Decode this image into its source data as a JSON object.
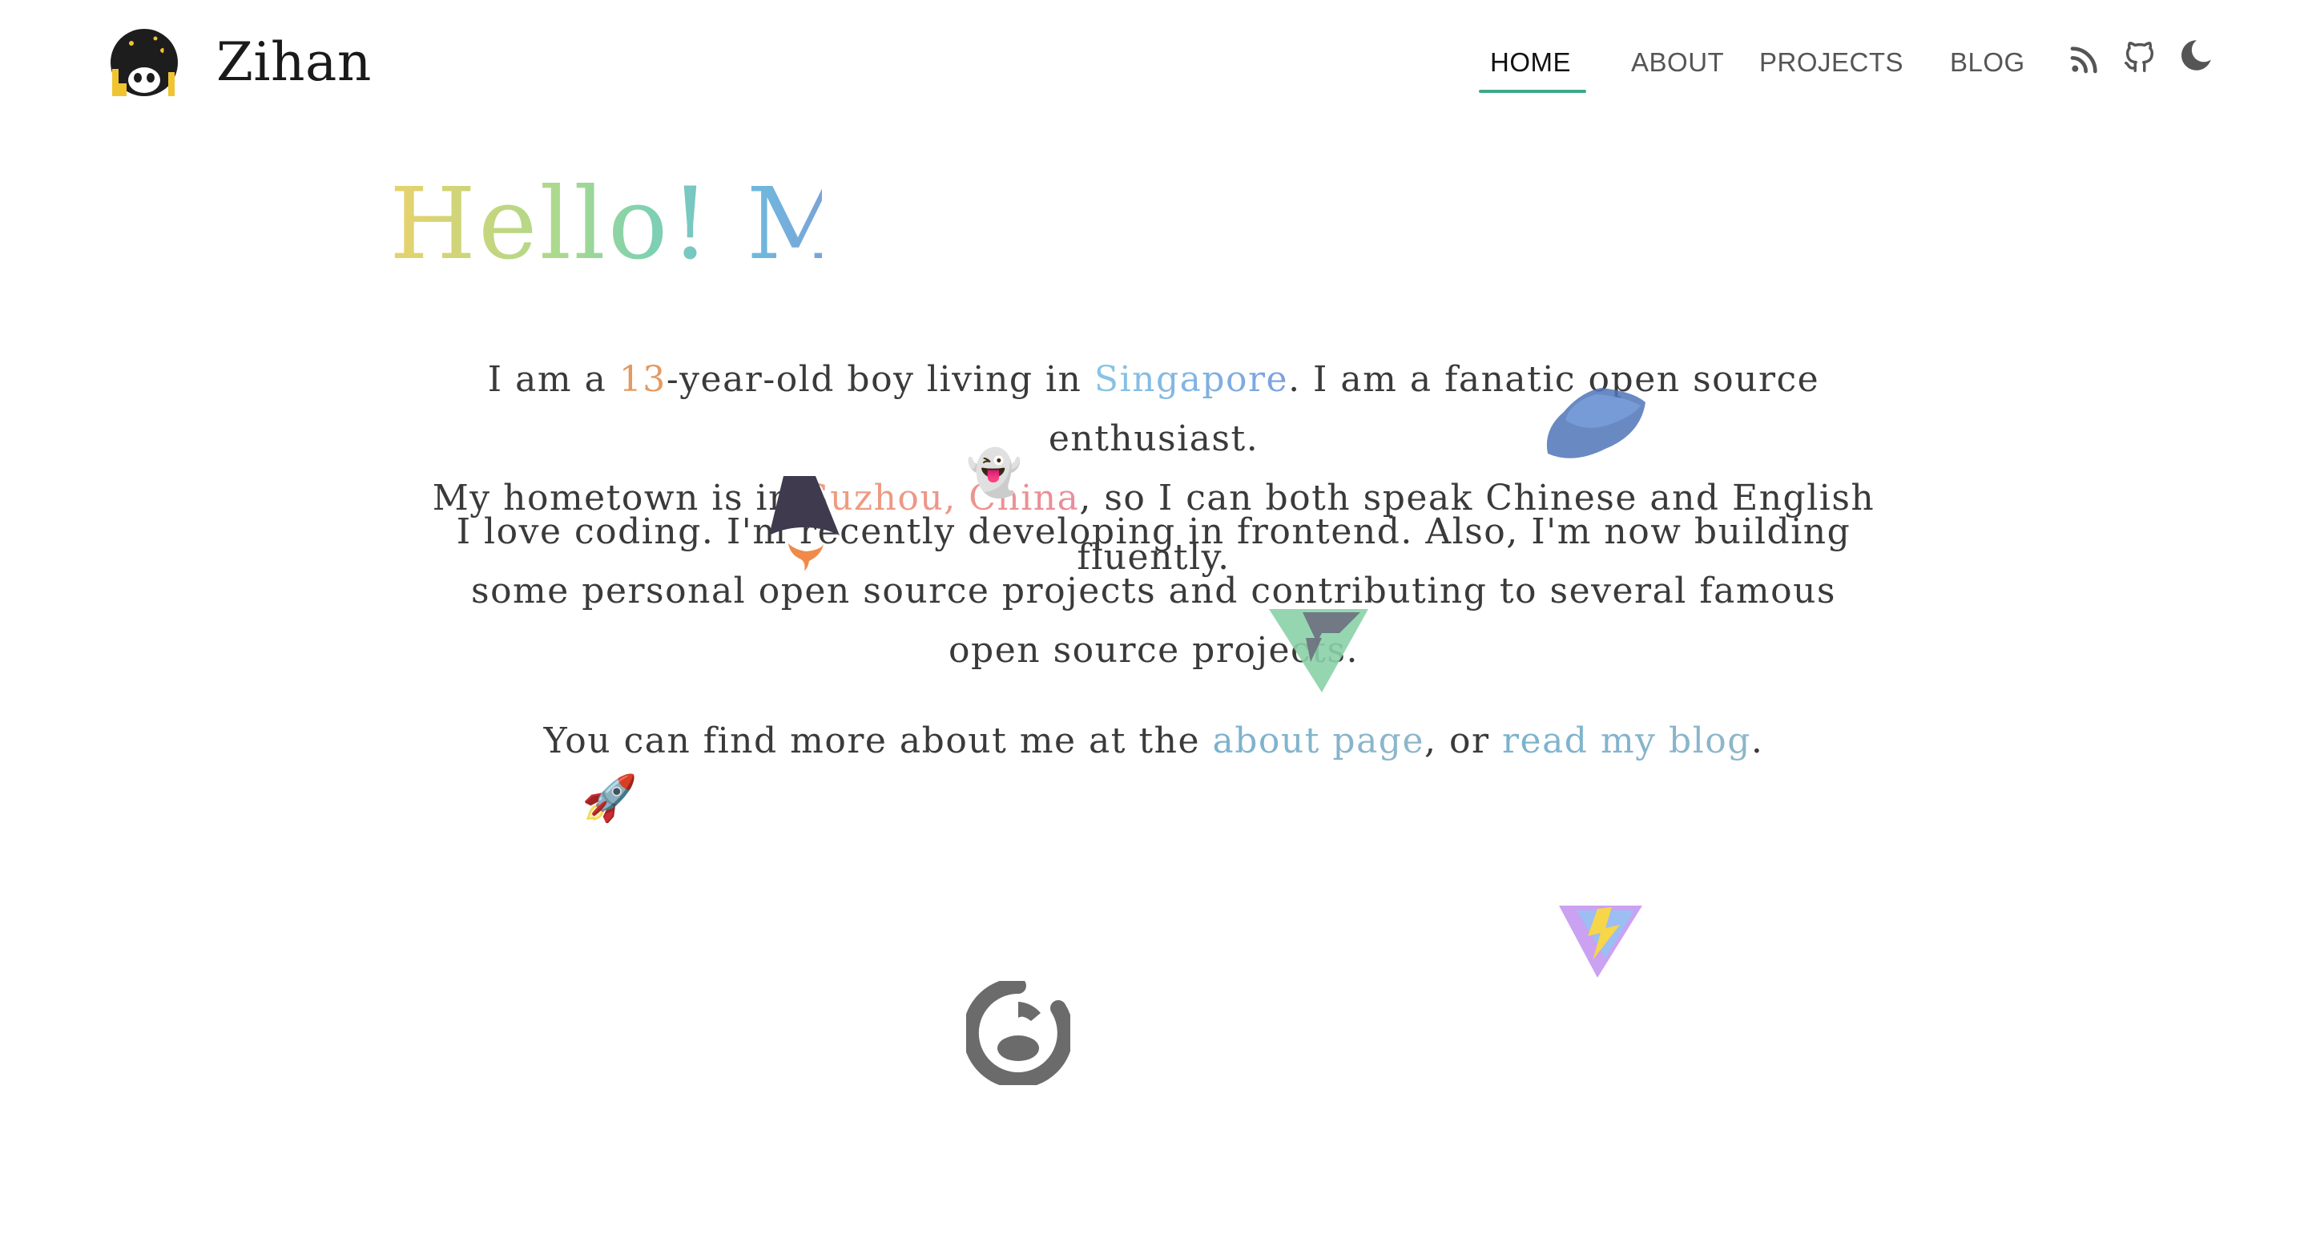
{
  "header": {
    "site_title": "Zihan",
    "nav": [
      {
        "label": "HOME",
        "active": true
      },
      {
        "label": "ABOUT",
        "active": false
      },
      {
        "label": "PROJECTS",
        "active": false
      },
      {
        "label": "BLOG",
        "active": false
      }
    ],
    "icons": [
      "rss-icon",
      "github-icon",
      "moon-icon"
    ],
    "accent_color": "#3fa989"
  },
  "main": {
    "hero_text": "Hello! M",
    "paragraph1": {
      "t1": "I am a ",
      "age": "13",
      "t2": "-year-old boy living in ",
      "city": "Singapore",
      "t3": ". I am a fanatic open source enthusiast.",
      "t4": "My hometown is in ",
      "hometown": "Suzhou, China",
      "t5": ", so I can both speak Chinese and English fluently."
    },
    "paragraph2": "I love coding. I'm recently developing in frontend. Also, I'm now building some personal open source projects and contributing to several famous open source projects.",
    "paragraph3": {
      "t1": "You can find more about me at the ",
      "about_link": "about page",
      "t2": ", or ",
      "blog_link": "read my blog",
      "t3": "."
    },
    "floating_icons": [
      "ghost-emoji-icon",
      "astro-logo-icon",
      "svelte-logo-icon",
      "vue-triangle-icon",
      "rocket-emoji-icon",
      "vite-logo-icon",
      "nuxt-ring-icon"
    ]
  }
}
